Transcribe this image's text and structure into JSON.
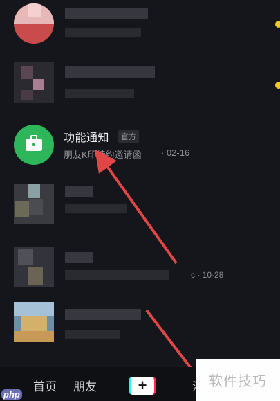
{
  "colors": {
    "background": "#15161b",
    "unread_dot": "#f3c623",
    "notice_avatar": "#2eb65a",
    "arrow": "#e04646"
  },
  "list": {
    "feature_item": {
      "icon": "briefcase-icon",
      "title": "功能通知",
      "tag": "官方",
      "subtitle": "朋友K印特约邀请函",
      "time": "· 02-16"
    },
    "other_time": "c · 10-28"
  },
  "tabbar": {
    "home": "首页",
    "friends": "朋友",
    "plus": "+",
    "message_partial": "消"
  },
  "watermark": "软件技巧",
  "php_logo": "php"
}
